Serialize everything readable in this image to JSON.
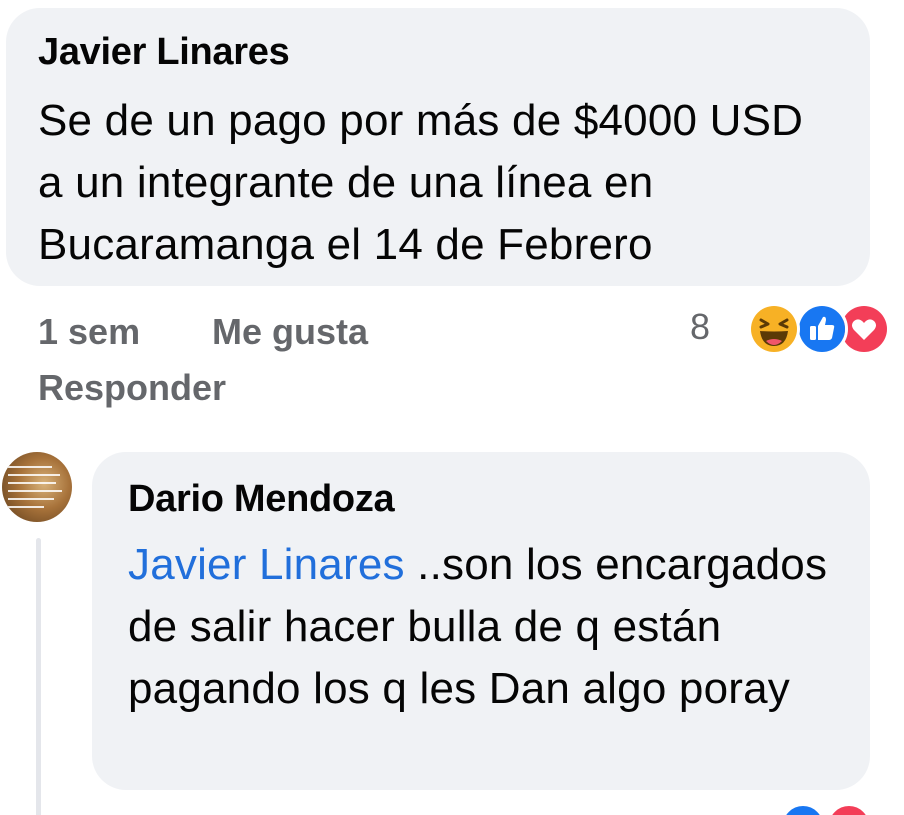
{
  "comment": {
    "author": "Javier Linares",
    "text": "Se de un pago por más de $4000 USD a un integrante de una línea en Bucaramanga el 14 de Febrero",
    "time": "1 sem",
    "like_label": "Me gusta",
    "reply_label": "Responder",
    "reaction_count": "8",
    "reaction_icons": [
      "haha-icon",
      "like-icon",
      "love-icon"
    ]
  },
  "reply": {
    "author": "Dario Mendoza",
    "mention": "Javier Linares",
    "text": " ..son los encargados de salir hacer bulla de q están pagando los q les Dan algo poray"
  },
  "colors": {
    "bubble": "#f0f2f5",
    "text": "#050505",
    "meta": "#65676b",
    "mention": "#216fdb",
    "like": "#1877f2",
    "love": "#f33e58",
    "haha": "#f7b125"
  }
}
